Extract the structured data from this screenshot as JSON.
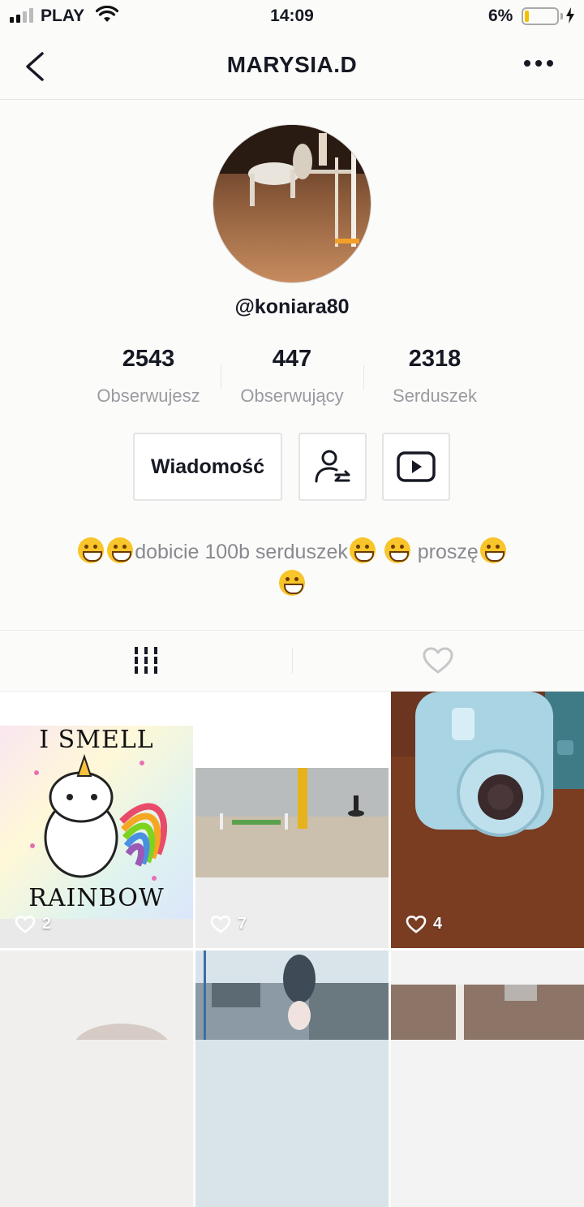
{
  "status_bar": {
    "carrier": "PLAY",
    "time": "14:09",
    "battery_percent": "6%",
    "battery_level": 0.06
  },
  "nav": {
    "title": "MARYSIA.D",
    "back_icon": "chevron-left-icon",
    "more_icon": "more-horizontal-icon"
  },
  "profile": {
    "username": "@koniara80",
    "stats": [
      {
        "value": "2543",
        "label": "Obserwujesz"
      },
      {
        "value": "447",
        "label": "Obserwujący"
      },
      {
        "value": "2318",
        "label": "Serduszek"
      }
    ],
    "buttons": {
      "message_label": "Wiadomość",
      "follow_icon": "user-swap-icon",
      "youtube_icon": "play-box-icon"
    },
    "bio": {
      "text1": "dobicie 100b serduszek",
      "text2": " proszę"
    }
  },
  "tabs": [
    {
      "icon": "grid-icon",
      "active": true
    },
    {
      "icon": "heart-icon",
      "active": false
    }
  ],
  "videos": [
    {
      "likes": "2",
      "caption_top": "I SMELL",
      "caption_bottom": "RAINBOW"
    },
    {
      "likes": "7"
    },
    {
      "likes": "4"
    },
    {
      "likes": ""
    },
    {
      "likes": ""
    },
    {
      "likes": ""
    }
  ],
  "colors": {
    "primary_text": "#161823",
    "secondary_text": "#9a9ba0",
    "battery_fill": "#f2c200"
  }
}
